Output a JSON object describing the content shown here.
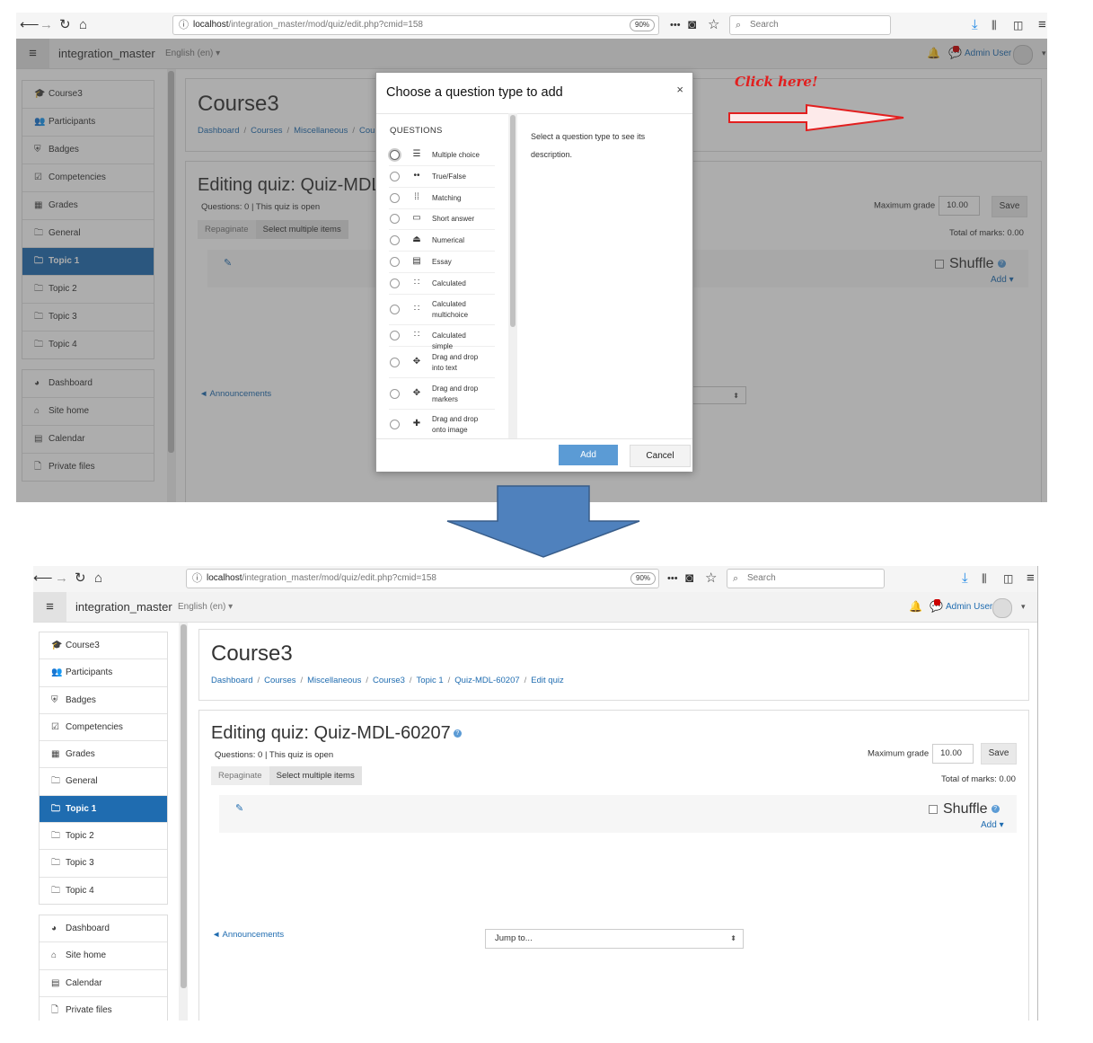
{
  "browser": {
    "url_host": "localhost",
    "url_path": "/integration_master/mod/quiz/edit.php?cmid=158",
    "zoom": "90%",
    "search_placeholder": "Search",
    "more": "•••"
  },
  "navbar": {
    "brand": "integration_master",
    "language": "English (en)",
    "user": "Admin User"
  },
  "sidebar": {
    "group1": [
      {
        "icon": "graduation-cap-icon",
        "glyph": "🎓",
        "label": "Course3"
      },
      {
        "icon": "users-icon",
        "glyph": "👥",
        "label": "Participants"
      },
      {
        "icon": "shield-icon",
        "glyph": "⛨",
        "label": "Badges"
      },
      {
        "icon": "check-square-icon",
        "glyph": "☑",
        "label": "Competencies"
      },
      {
        "icon": "table-icon",
        "glyph": "▦",
        "label": "Grades"
      },
      {
        "icon": "folder-icon",
        "glyph": "🗀",
        "label": "General"
      },
      {
        "icon": "folder-icon",
        "glyph": "🗀",
        "label": "Topic 1"
      },
      {
        "icon": "folder-icon",
        "glyph": "🗀",
        "label": "Topic 2"
      },
      {
        "icon": "folder-icon",
        "glyph": "🗀",
        "label": "Topic 3"
      },
      {
        "icon": "folder-icon",
        "glyph": "🗀",
        "label": "Topic 4"
      }
    ],
    "group2": [
      {
        "icon": "dashboard-icon",
        "glyph": "◕",
        "label": "Dashboard"
      },
      {
        "icon": "home-icon",
        "glyph": "⌂",
        "label": "Site home"
      },
      {
        "icon": "calendar-icon",
        "glyph": "▤",
        "label": "Calendar"
      },
      {
        "icon": "file-icon",
        "glyph": "🗋",
        "label": "Private files"
      }
    ],
    "active": "Topic 1"
  },
  "page": {
    "course_title": "Course3",
    "breadcrumb_full": [
      "Dashboard",
      "Courses",
      "Miscellaneous",
      "Course3",
      "Topic 1",
      "Quiz-MDL-60207",
      "Edit quiz"
    ],
    "breadcrumb_partial": [
      "Dashboard",
      "Courses",
      "Miscellaneous",
      "Cou"
    ],
    "quiz_heading": "Editing quiz: Quiz-MDL-60207",
    "quiz_heading_partial": "Editing quiz: Quiz-MDL",
    "quiz_info": "Questions: 0 | This quiz is open",
    "repaginate": "Repaginate",
    "select_multiple": "Select multiple items",
    "max_grade_label": "Maximum grade",
    "max_grade_value": "10.00",
    "save": "Save",
    "total_marks": "Total of marks: 0.00",
    "shuffle": "Shuffle",
    "add": "Add",
    "announcements": "◄ Announcements",
    "jump_to": "Jump to..."
  },
  "modal": {
    "title": "Choose a question type to add",
    "close": "×",
    "section_label": "QUESTIONS",
    "description": "Select a question type to see its description.",
    "add_button": "Add",
    "cancel_button": "Cancel",
    "question_types": [
      {
        "label": "Multiple choice",
        "glyph": "☰",
        "icon": "multichoice-icon"
      },
      {
        "label": "True/False",
        "glyph": "••",
        "icon": "truefalse-icon"
      },
      {
        "label": "Matching",
        "glyph": "⁞⁞",
        "icon": "matching-icon"
      },
      {
        "label": "Short answer",
        "glyph": "▭",
        "icon": "shortanswer-icon"
      },
      {
        "label": "Numerical",
        "glyph": "⏏",
        "icon": "numerical-icon"
      },
      {
        "label": "Essay",
        "glyph": "▤",
        "icon": "essay-icon"
      },
      {
        "label": "Calculated",
        "glyph": "∷",
        "icon": "calculated-icon"
      },
      {
        "label": "Calculated multichoice",
        "glyph": "∷",
        "icon": "calculated-multichoice-icon"
      },
      {
        "label": "Calculated simple",
        "glyph": "∷",
        "icon": "calculated-simple-icon"
      },
      {
        "label": "Drag and drop into text",
        "glyph": "✥",
        "icon": "ddwtos-icon"
      },
      {
        "label": "Drag and drop markers",
        "glyph": "✥",
        "icon": "ddmarker-icon"
      },
      {
        "label": "Drag and drop onto image",
        "glyph": "✚",
        "icon": "ddimage-icon"
      }
    ]
  },
  "annotation": {
    "text": "Click here!",
    "color": "#e21f1f"
  },
  "colors": {
    "accent": "#1f6cb0",
    "arrow": "#4f81bd",
    "add_button": "#5b9bd5"
  }
}
